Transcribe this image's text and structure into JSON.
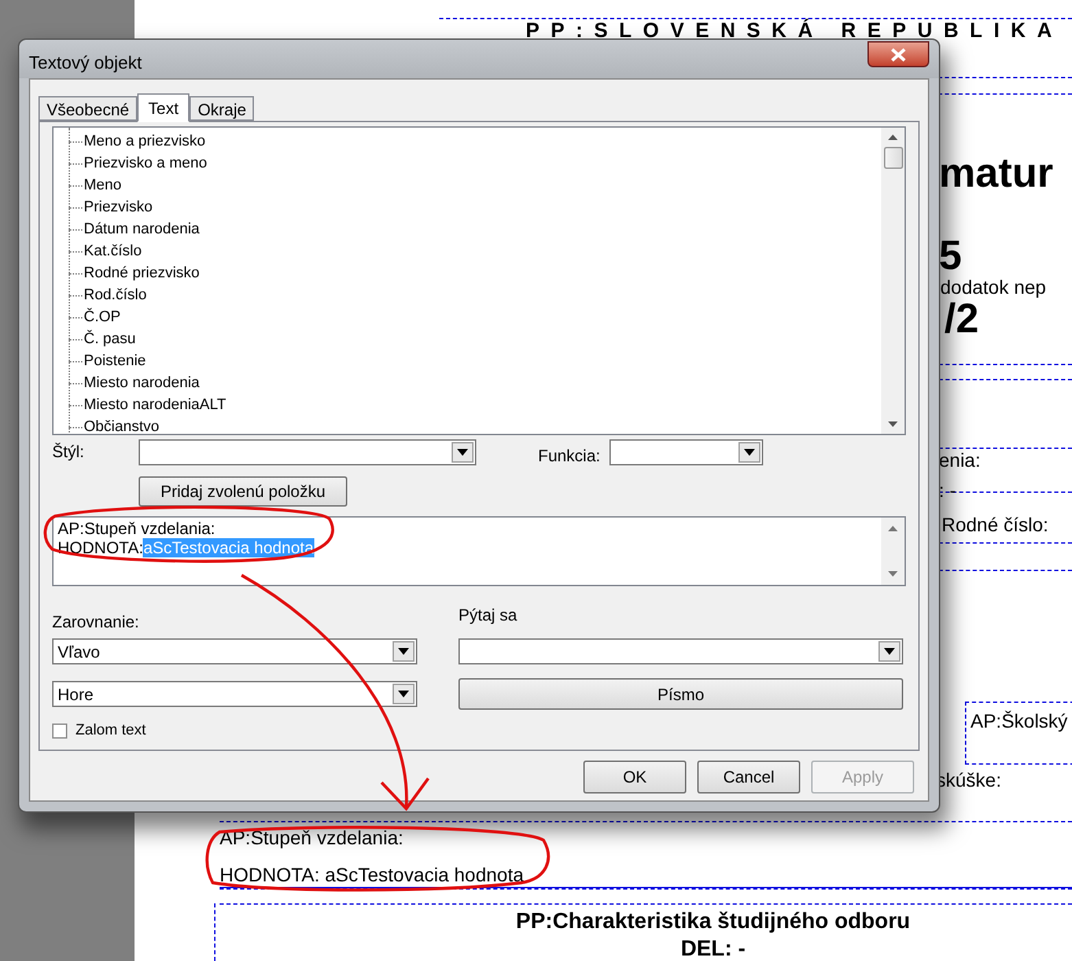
{
  "document": {
    "header": "PP:SLOVENSKÁ REPUBLIKA",
    "fragments": [
      {
        "kind": "big",
        "text": "matur"
      },
      {
        "kind": "big",
        "text": "5"
      },
      {
        "kind": "plain",
        "text": "dodatok nep"
      },
      {
        "kind": "big",
        "text": "/2"
      },
      {
        "kind": "plain",
        "text": "enia:"
      },
      {
        "kind": "plain",
        "text": ": -"
      },
      {
        "kind": "plain",
        "text": "Rodné číslo:"
      },
      {
        "kind": "boxed",
        "text": "AP:Školský"
      },
      {
        "kind": "plain",
        "text": "skúške:"
      }
    ],
    "selected_field": {
      "lines": [
        "AP:Stupeň vzdelania:",
        "HODNOTA: aScTestovacia hodnota"
      ]
    },
    "section_title": "PP:Charakteristika študijného odboru",
    "section_subtitle": "DEL: -"
  },
  "dialog": {
    "title": "Textový objekt",
    "tabs": [
      {
        "label": "Všeobecné",
        "selected": false
      },
      {
        "label": "Text",
        "selected": true
      },
      {
        "label": "Okraje",
        "selected": false
      }
    ],
    "field_tree": {
      "items": [
        "Meno a priezvisko",
        "Priezvisko a meno",
        "Meno",
        "Priezvisko",
        "Dátum narodenia",
        "Kat.číslo",
        "Rodné priezvisko",
        "Rod.číslo",
        "Č.OP",
        "Č. pasu",
        "Poistenie",
        "Miesto narodenia",
        "Miesto narodeniaALT",
        "Občianstvo"
      ]
    },
    "style_label": "Štýl:",
    "function_label": "Funkcia:",
    "add_button": "Pridaj zvolenú položku",
    "text_editor": {
      "lines": [
        {
          "text": "AP:Stupeň vzdelania:"
        },
        {
          "text": "HODNOTA:",
          "selection": "aScTestovacia hodnota"
        }
      ]
    },
    "alignment_label": "Zarovnanie:",
    "alignment_value": "Vľavo",
    "vertical_value": "Hore",
    "wrap_checkbox": {
      "label": "Zalom text",
      "checked": false
    },
    "ask_label": "Pýtaj sa",
    "font_button": "Písmo",
    "buttons": [
      {
        "label": "OK",
        "disabled": false
      },
      {
        "label": "Cancel",
        "disabled": false
      },
      {
        "label": "Apply",
        "disabled": true
      }
    ]
  }
}
